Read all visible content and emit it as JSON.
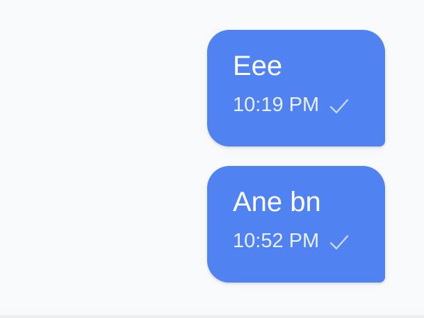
{
  "messages": [
    {
      "text": "Eee",
      "time": "10:19 PM",
      "status_icon": "check-icon"
    },
    {
      "text": "Ane bn",
      "time": "10:52 PM",
      "status_icon": "check-icon"
    }
  ],
  "colors": {
    "background": "#f8f9fb",
    "bubble": "#5083f1",
    "bubble_text": "#ffffff"
  }
}
